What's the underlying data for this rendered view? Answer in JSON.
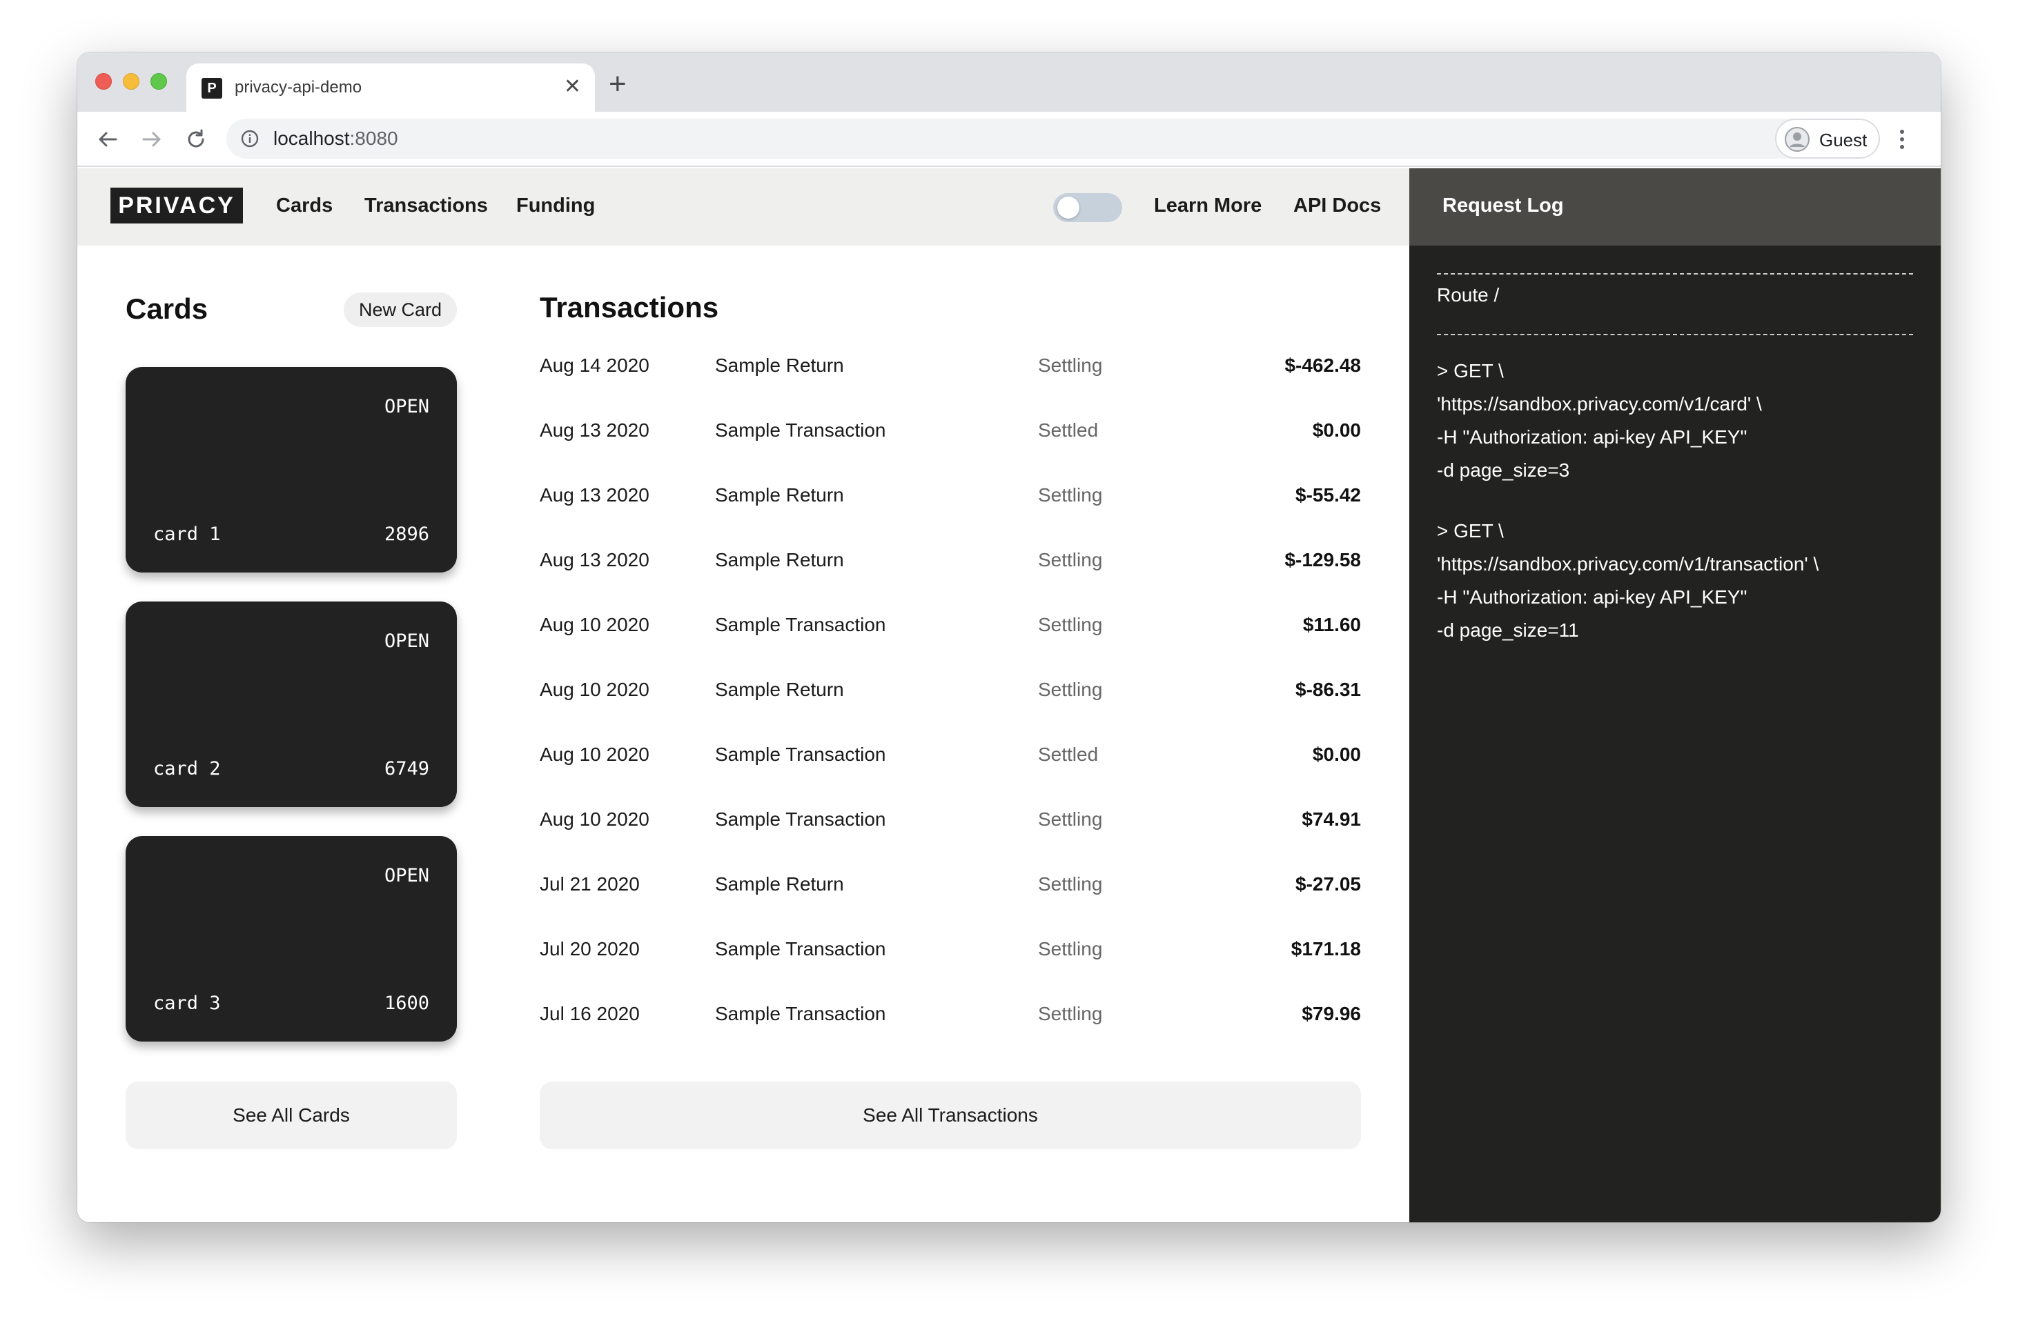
{
  "browser": {
    "tab_title": "privacy-api-demo",
    "favicon_letter": "P",
    "url_host": "localhost",
    "url_port": ":8080",
    "profile_name": "Guest"
  },
  "header": {
    "logo": "PRIVACY",
    "nav": [
      "Cards",
      "Transactions",
      "Funding"
    ],
    "learn_more": "Learn More",
    "api_docs": "API Docs"
  },
  "cards_section": {
    "title": "Cards",
    "new_card": "New Card",
    "cards": [
      {
        "state": "OPEN",
        "name": "card 1",
        "last4": "2896"
      },
      {
        "state": "OPEN",
        "name": "card 2",
        "last4": "6749"
      },
      {
        "state": "OPEN",
        "name": "card 3",
        "last4": "1600"
      }
    ],
    "see_all": "See All Cards"
  },
  "transactions_section": {
    "title": "Transactions",
    "rows": [
      {
        "date": "Aug 14 2020",
        "description": "Sample Return",
        "status": "Settling",
        "amount": "$-462.48"
      },
      {
        "date": "Aug 13 2020",
        "description": "Sample Transaction",
        "status": "Settled",
        "amount": "$0.00"
      },
      {
        "date": "Aug 13 2020",
        "description": "Sample Return",
        "status": "Settling",
        "amount": "$-55.42"
      },
      {
        "date": "Aug 13 2020",
        "description": "Sample Return",
        "status": "Settling",
        "amount": "$-129.58"
      },
      {
        "date": "Aug 10 2020",
        "description": "Sample Transaction",
        "status": "Settling",
        "amount": "$11.60"
      },
      {
        "date": "Aug 10 2020",
        "description": "Sample Return",
        "status": "Settling",
        "amount": "$-86.31"
      },
      {
        "date": "Aug 10 2020",
        "description": "Sample Transaction",
        "status": "Settled",
        "amount": "$0.00"
      },
      {
        "date": "Aug 10 2020",
        "description": "Sample Transaction",
        "status": "Settling",
        "amount": "$74.91"
      },
      {
        "date": "Jul 21 2020",
        "description": "Sample Return",
        "status": "Settling",
        "amount": "$-27.05"
      },
      {
        "date": "Jul 20 2020",
        "description": "Sample Transaction",
        "status": "Settling",
        "amount": "$171.18"
      },
      {
        "date": "Jul 16 2020",
        "description": "Sample Transaction",
        "status": "Settling",
        "amount": "$79.96"
      }
    ],
    "see_all": "See All Transactions"
  },
  "request_log": {
    "title": "Request Log",
    "route": "Route /",
    "requests": [
      [
        "> GET \\",
        "'https://sandbox.privacy.com/v1/card' \\",
        "-H \"Authorization: api-key API_KEY\"",
        "-d page_size=3"
      ],
      [
        "> GET \\",
        "'https://sandbox.privacy.com/v1/transaction' \\",
        "-H \"Authorization: api-key API_KEY\"",
        "-d page_size=11"
      ]
    ]
  },
  "colors": {
    "card_bg": "#222222",
    "header_bg": "#efefed",
    "log_bg": "#222220",
    "log_header_bg": "#4a4945",
    "toggle_bg": "#c7d1dc"
  },
  "toggle_on": false
}
